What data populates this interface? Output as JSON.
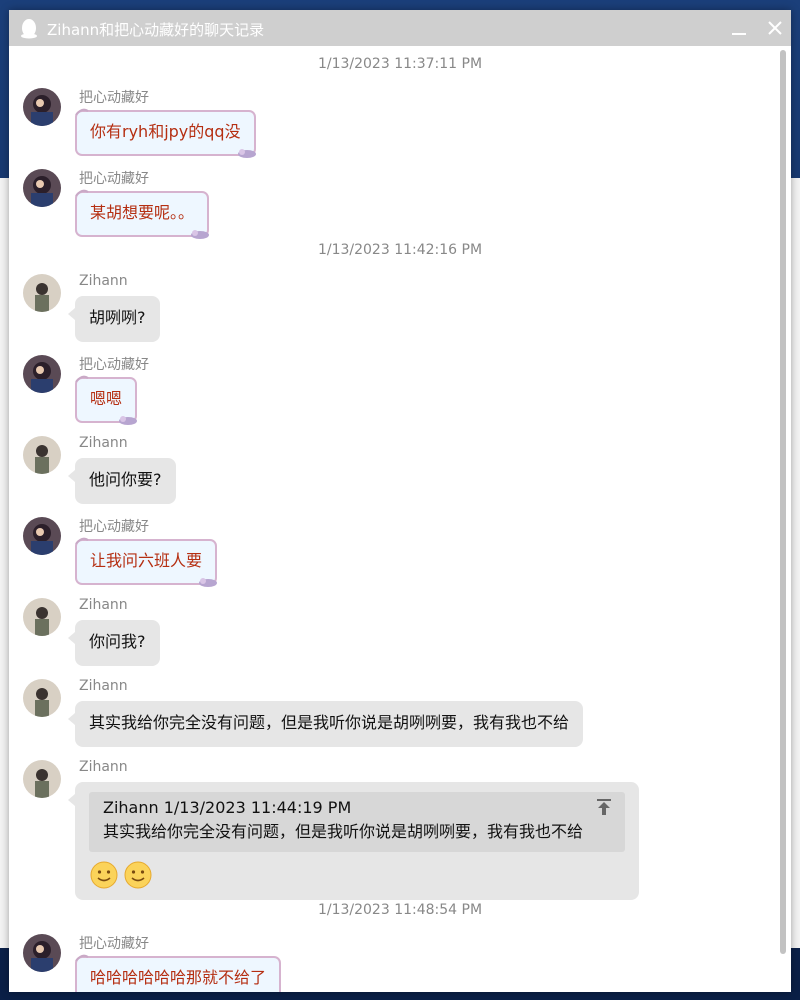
{
  "window": {
    "title": "Zihann和把心动藏好的聊天记录"
  },
  "messages": [
    {
      "type": "timestamp",
      "text": "1/13/2023 11:37:11 PM"
    },
    {
      "type": "msg",
      "sender": "把心动藏好",
      "text": "你有ryh和jpy的qq没",
      "style": "fancy"
    },
    {
      "type": "msg",
      "sender": "把心动藏好",
      "text": "某胡想要呢。。",
      "style": "fancy"
    },
    {
      "type": "timestamp",
      "text": "1/13/2023 11:42:16 PM"
    },
    {
      "type": "msg",
      "sender": "Zihann",
      "text": "胡咧咧?",
      "style": "grey"
    },
    {
      "type": "msg",
      "sender": "把心动藏好",
      "text": "嗯嗯",
      "style": "fancy"
    },
    {
      "type": "msg",
      "sender": "Zihann",
      "text": "他问你要?",
      "style": "grey"
    },
    {
      "type": "msg",
      "sender": "把心动藏好",
      "text": "让我问六班人要",
      "style": "fancy"
    },
    {
      "type": "msg",
      "sender": "Zihann",
      "text": "你问我?",
      "style": "grey"
    },
    {
      "type": "msg",
      "sender": "Zihann",
      "text": "其实我给你完全没有问题，但是我听你说是胡咧咧要，我有我也不给",
      "style": "grey"
    },
    {
      "type": "msg",
      "sender": "Zihann",
      "style": "grey-quote",
      "quote": {
        "header": "Zihann  1/13/2023 11:44:19 PM",
        "text": "其实我给你完全没有问题，但是我听你说是胡咧咧要，我有我也不给"
      },
      "emojis": [
        "smile-emoji",
        "smile-emoji"
      ]
    },
    {
      "type": "timestamp",
      "text": "1/13/2023 11:48:54 PM"
    },
    {
      "type": "msg",
      "sender": "把心动藏好",
      "text": "哈哈哈哈哈哈那就不给了",
      "style": "fancy"
    }
  ],
  "colors": {
    "titlebar": "#cfcfcf",
    "grey_bubble": "#e6e6e6",
    "fancy_bubble_bg": "#eef7ff",
    "fancy_bubble_text": "#b52f12",
    "timestamp_text": "#888888"
  }
}
